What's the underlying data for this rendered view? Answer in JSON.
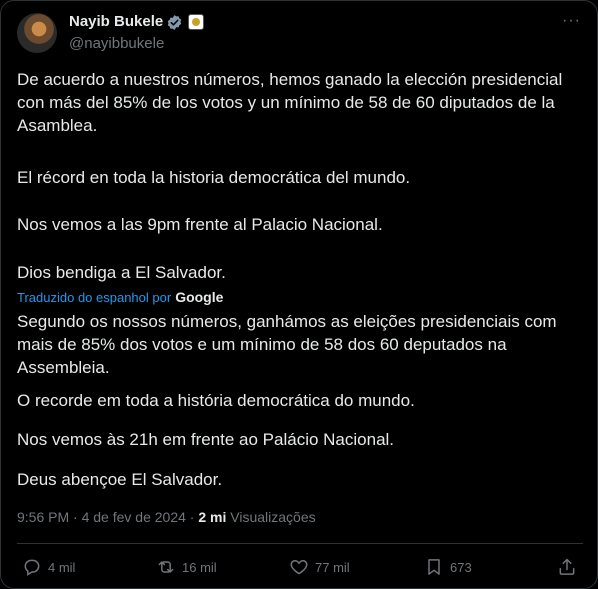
{
  "author": {
    "name": "Nayib Bukele",
    "handle": "@nayibbukele"
  },
  "more_icon": "···",
  "tweet": {
    "p1": "De acuerdo a nuestros números, hemos ganado la elección presidencial con más del 85% de los votos y un mínimo de 58 de 60 diputados de la Asamblea.",
    "p2": "El récord en toda la historia democrática del mundo.",
    "p3": "Nos vemos a las 9pm frente al Palacio Nacional.",
    "p4": "Dios bendiga a El Salvador."
  },
  "translation": {
    "label": "Traduzido do espanhol por",
    "provider": "Google",
    "p1": "Segundo os nossos números, ganhámos as eleições presidenciais com mais de 85% dos votos e um mínimo de 58 dos 60 deputados na Assembleia.",
    "p2": "O recorde em toda a história democrática do mundo.",
    "p3": "Nos vemos às 21h em frente ao Palácio Nacional.",
    "p4": "Deus abençoe El Salvador."
  },
  "meta": {
    "time": "9:56 PM",
    "sep": "·",
    "date": "4 de fev de 2024",
    "views_count": "2 mi",
    "views_label": "Visualizações"
  },
  "actions": {
    "replies": "4 mil",
    "reposts": "16 mil",
    "likes": "77 mil",
    "bookmarks": "673"
  },
  "colors": {
    "background": "#000000",
    "text": "#e7e9ea",
    "muted": "#71767b",
    "link": "#1d9bf0",
    "verified": "#829aab"
  }
}
